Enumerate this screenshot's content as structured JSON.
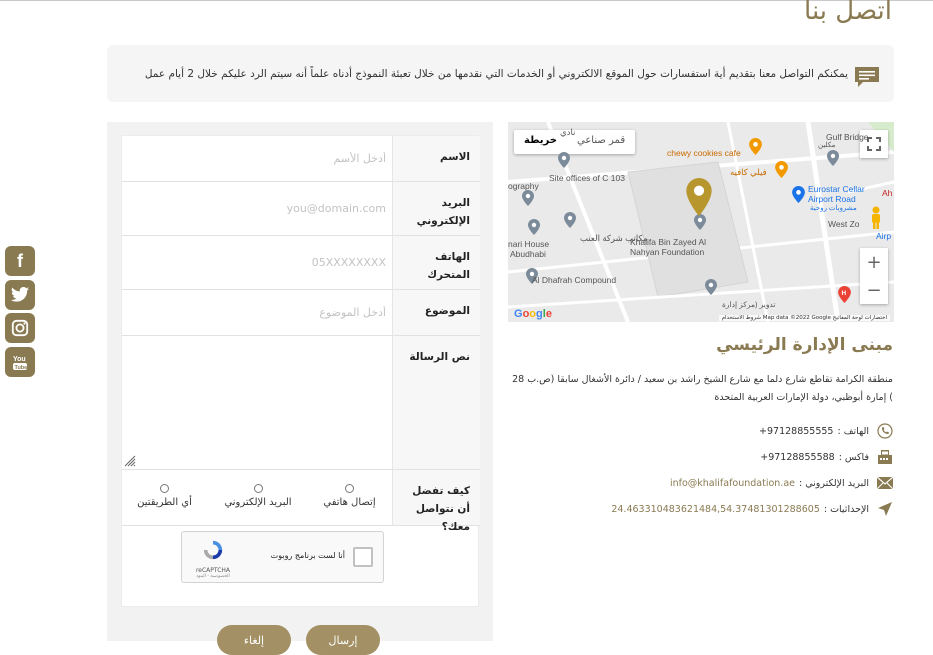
{
  "page": {
    "title": "اتصل بنا"
  },
  "intro": {
    "text": "يمكنكم التواصل معنا بتقديم أية استفسارات حول الموقع الالكتروني أو الخدمات التي نقدمها من خلال تعبئة النموذج أدناه علماً أنه سيتم الرد عليكم خلال 2 أيام عمل",
    "icon": "message-icon"
  },
  "social": [
    {
      "name": "facebook-icon",
      "glyph": "f"
    },
    {
      "name": "twitter-icon",
      "glyph": "🐦"
    },
    {
      "name": "instagram-icon",
      "glyph": "◎"
    },
    {
      "name": "youtube-icon",
      "glyph": "You"
    }
  ],
  "form": {
    "name": {
      "label": "الاسم",
      "placeholder": "أدخل الأسم"
    },
    "email": {
      "label": "البريد الإلكتروني",
      "placeholder": "you@domain.com"
    },
    "phone": {
      "label": "الهاتف المتحرك",
      "placeholder": "05XXXXXXXX"
    },
    "subject": {
      "label": "الموضوع",
      "placeholder": "أدخل الموضوع"
    },
    "message": {
      "label": "نص الرسالة"
    },
    "contact_pref": {
      "label": "كيف تفضل أن نتواصل معك؟",
      "options": [
        "إتصال هاتفي",
        "البريد الإلكتروني",
        "أي الطريقتين"
      ]
    },
    "captcha": {
      "label": "أنا لست برنامج روبوت",
      "brand": "reCAPTCHA",
      "terms": "الخصوصية - البنود"
    }
  },
  "map": {
    "tabs": [
      "قمر صناعي",
      "خريطة"
    ],
    "active_tab": "خريطة",
    "zoom_in": "+",
    "zoom_out": "−",
    "labels": {
      "gulf_bridge": "Gulf Bridge",
      "chewy": "chewy cookies cafe",
      "filli": "فيلي كافيه",
      "eurostar1": "Eurostar Cellar",
      "eurostar2": "Airport Road",
      "eurostar3": "مشروبات روحية",
      "westzone": "West Zo",
      "site_offices": "Site offices of C 103",
      "graphy": "ography",
      "enabi": "مكاتب شركة العنب",
      "kbz1": "Khalifa Bin Zayed Al",
      "kbz2": "Nahyan Foundation",
      "house1": "nari House",
      "house2": "Abudhabi",
      "dhafrah": "Al Dhafrah Compound",
      "tadweer": "تدوير (مركز إدارة",
      "ah": "Ah",
      "airp": "Airp",
      "nadi": "نادي",
      "mkln": "مكلين"
    },
    "google": "Google",
    "footer": "اختصارات لوحة المفاتيح   Map data ©2022 Google   شروط الاستخدام"
  },
  "office": {
    "title": "مبنى الإدارة الرئيسي",
    "address": "منطقة الكرامة تقاطع شارع دلما مع شارع الشيخ راشد بن سعيد / دائرة الأشغال سابقا (ص.ب 28 ) إمارة أبوظبي، دولة الإمارات العربية المتحدة",
    "phone_label": "الهاتف :",
    "phone": "+97128855555",
    "fax_label": "فاكس :",
    "fax": "+97128855588",
    "email_label": "البريد الإلكتروني :",
    "email": "info@khalifafoundation.ae",
    "coords_label": "الإحداثيات :",
    "coords": "24.463310483621484,54.37481301288605"
  },
  "buttons": {
    "send": "إرسال",
    "reset": "إلغاء"
  },
  "colors": {
    "accent": "#8a7a52",
    "button": "#a39065"
  }
}
